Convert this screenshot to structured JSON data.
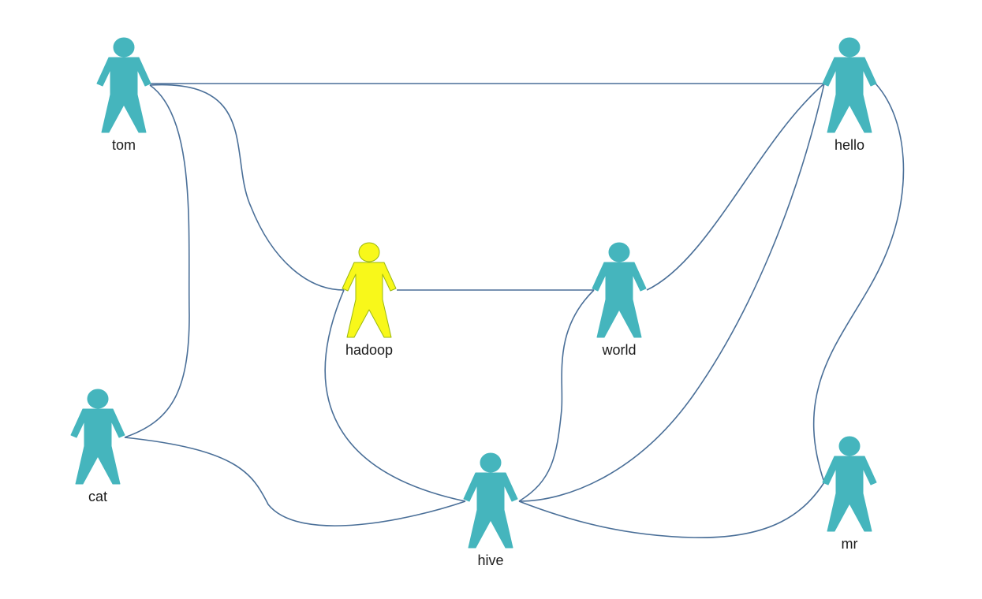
{
  "diagram": {
    "type": "network-graph",
    "default_node_color": "#45b5bd",
    "selected_node_color": "#f8f81a",
    "selected_node_outline": "#9bb80f",
    "edge_color": "#4a6f98",
    "node_icon": "person-icon",
    "nodes": [
      {
        "id": "tom",
        "label": "tom",
        "selected": false
      },
      {
        "id": "hello",
        "label": "hello",
        "selected": false
      },
      {
        "id": "hadoop",
        "label": "hadoop",
        "selected": true
      },
      {
        "id": "world",
        "label": "world",
        "selected": false
      },
      {
        "id": "cat",
        "label": "cat",
        "selected": false
      },
      {
        "id": "hive",
        "label": "hive",
        "selected": false
      },
      {
        "id": "mr",
        "label": "mr",
        "selected": false
      }
    ],
    "edges": [
      {
        "from": "tom",
        "to": "hello"
      },
      {
        "from": "tom",
        "to": "hadoop"
      },
      {
        "from": "tom",
        "to": "cat"
      },
      {
        "from": "hadoop",
        "to": "world"
      },
      {
        "from": "hadoop",
        "to": "hive"
      },
      {
        "from": "world",
        "to": "hello"
      },
      {
        "from": "world",
        "to": "hive"
      },
      {
        "from": "hello",
        "to": "hive"
      },
      {
        "from": "hello",
        "to": "mr"
      },
      {
        "from": "cat",
        "to": "hive"
      },
      {
        "from": "hive",
        "to": "mr"
      }
    ]
  }
}
